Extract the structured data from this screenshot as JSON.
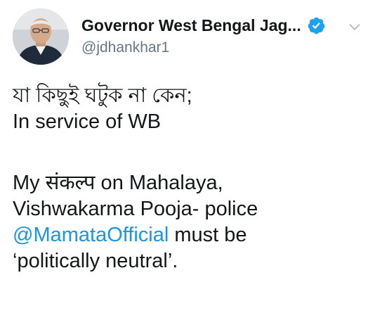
{
  "author": {
    "display_name": "Governor West Bengal Jag...",
    "handle": "@jdhankhar1",
    "verified_icon": "verified-badge-icon",
    "menu_icon": "chevron-down-icon"
  },
  "tweet": {
    "line1": "যা কিছুই ঘটুক না কেন;",
    "line2": "In service of WB",
    "line3": "My संकल्प  on Mahalaya,",
    "line4": "Vishwakarma Pooja- police",
    "mention": "@MamataOfficial",
    "line5_rest": " must be",
    "line6": "‘politically neutral’."
  },
  "colors": {
    "link": "#1b95e0",
    "verified": "#1da1f2",
    "text": "#14171a",
    "secondary": "#657786"
  }
}
